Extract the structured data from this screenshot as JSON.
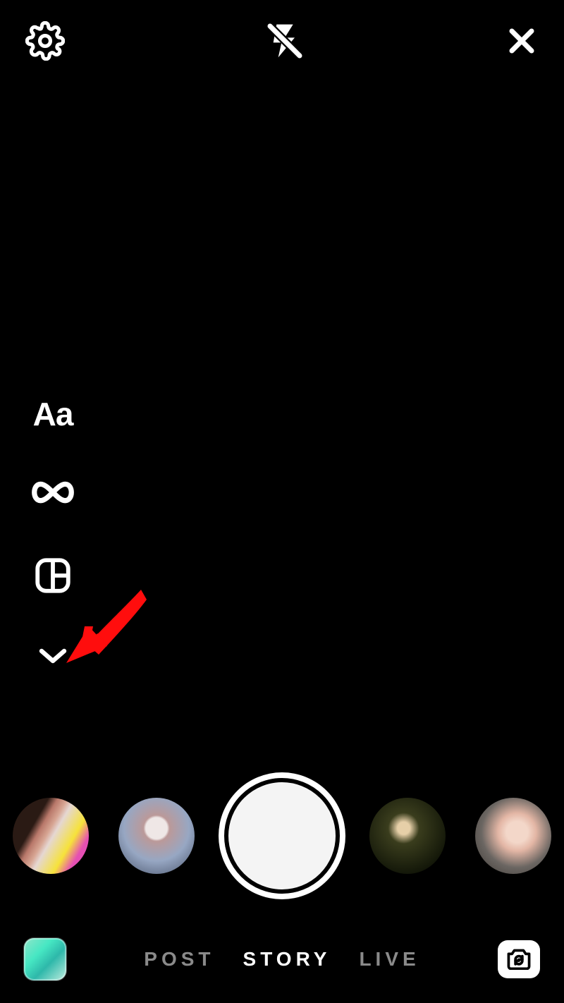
{
  "topbar": {
    "settings_icon": "settings-gear",
    "flash_icon": "flash-off",
    "close_icon": "close-x"
  },
  "tools": {
    "text_label": "Aa",
    "boomerang_icon": "infinity",
    "layout_icon": "layout-grid",
    "expand_icon": "chevron-down"
  },
  "annotation": {
    "arrow_icon": "red-arrow",
    "arrow_color": "#ff0000"
  },
  "filters": [
    {
      "name": "filter-1"
    },
    {
      "name": "filter-2"
    },
    {
      "name": "filter-3"
    },
    {
      "name": "filter-4"
    }
  ],
  "shutter": {
    "label": "capture"
  },
  "bottom": {
    "gallery_icon": "gallery-thumbnail",
    "modes": [
      {
        "id": "post",
        "label": "POST",
        "active": false
      },
      {
        "id": "story",
        "label": "STORY",
        "active": true
      },
      {
        "id": "live",
        "label": "LIVE",
        "active": false
      }
    ],
    "switch_camera_icon": "camera-switch"
  }
}
